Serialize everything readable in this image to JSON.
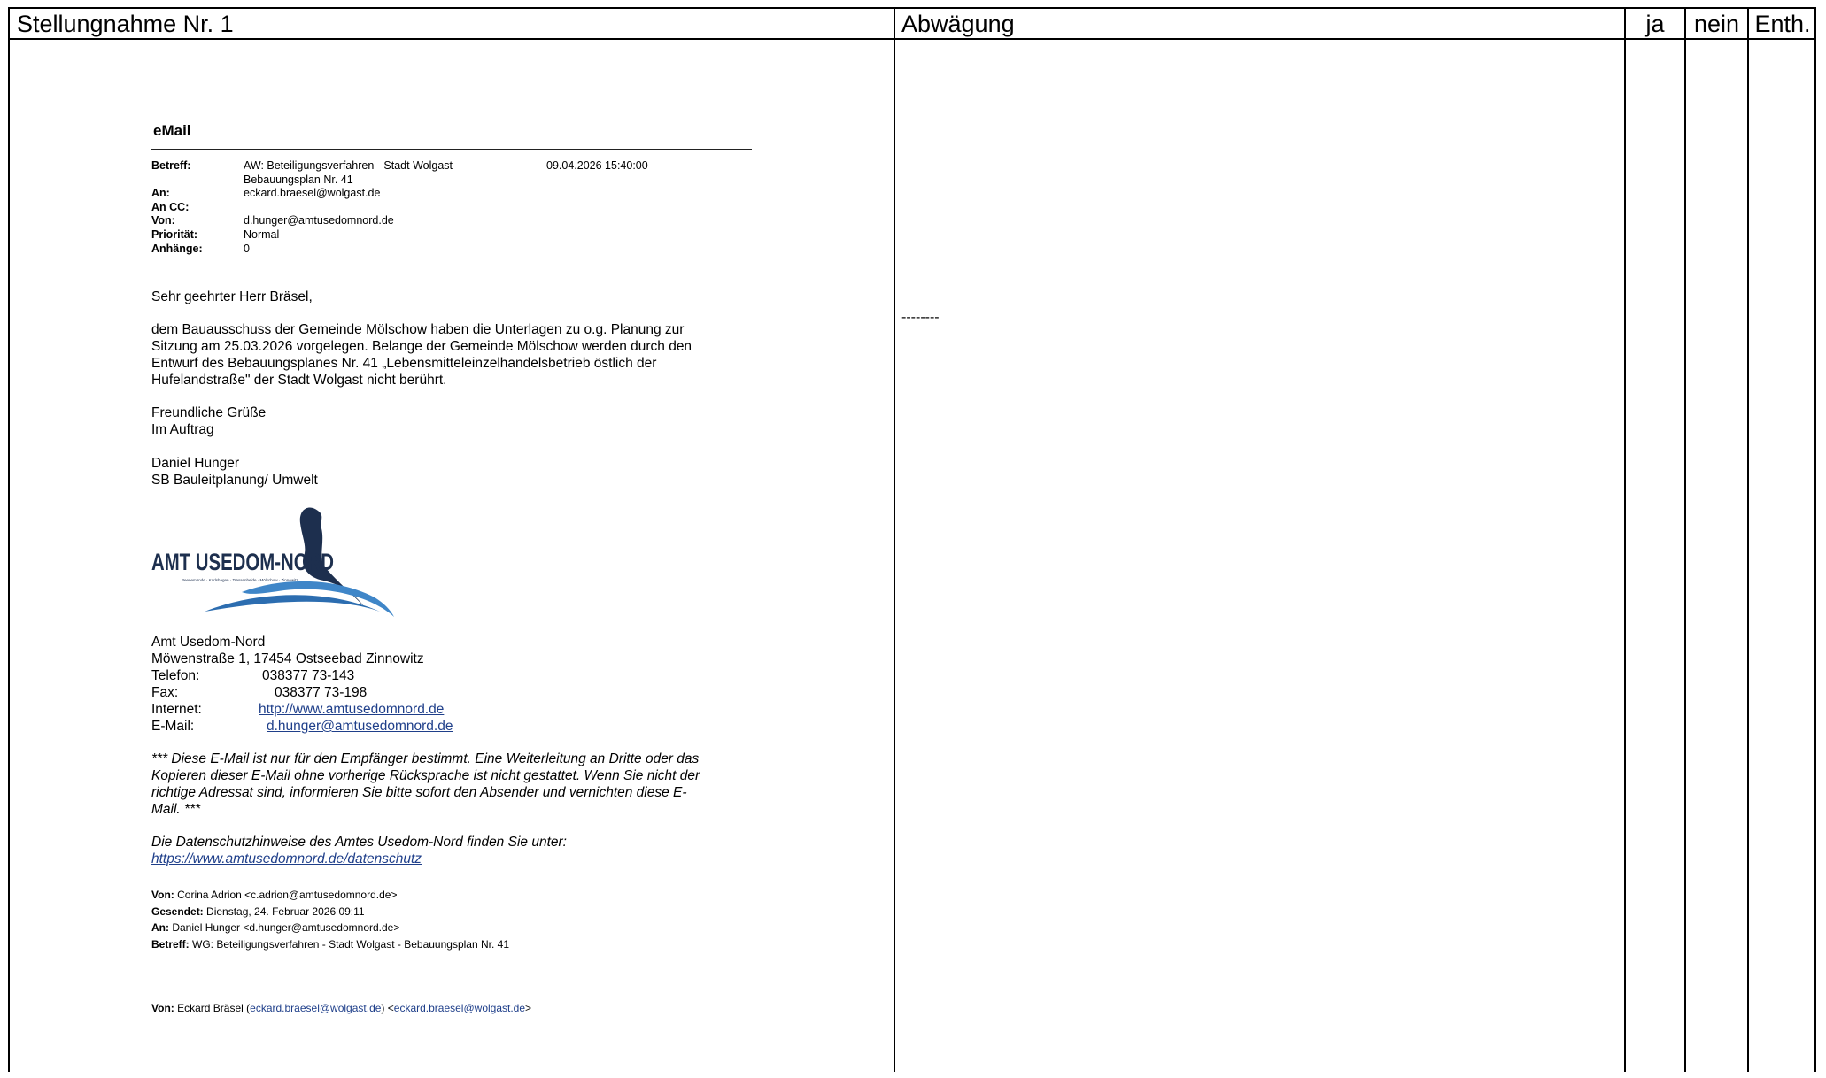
{
  "header": {
    "col1": "Stellungnahme Nr. 1",
    "col2": "Abwägung",
    "col3": "ja",
    "col4": "nein",
    "col5": "Enth."
  },
  "abwaegung_text": "--------",
  "email": {
    "title": "eMail",
    "meta": {
      "betreff_label": "Betreff:",
      "betreff_line1": "AW: Beteiligungsverfahren - Stadt Wolgast -",
      "betreff_line2": "Bebauungsplan Nr. 41",
      "date": "09.04.2026 15:40:00",
      "an_label": "An:",
      "an_value": "eckard.braesel@wolgast.de",
      "ancc_label": "An CC:",
      "von_label": "Von:",
      "von_value": "d.hunger@amtusedomnord.de",
      "prioritaet_label": "Priorität:",
      "prioritaet_value": "Normal",
      "anhaenge_label": "Anhänge:",
      "anhaenge_value": "0"
    },
    "salutation": "Sehr geehrter Herr Bräsel,",
    "body_lines": [
      "dem Bauausschuss der Gemeinde Mölschow haben die Unterlagen zu o.g. Planung zur",
      "Sitzung am 25.03.2026 vorgelegen. Belange der Gemeinde Mölschow werden durch den",
      "Entwurf des Bebauungsplanes Nr. 41 „Lebensmitteleinzelhandelsbetrieb östlich der",
      "Hufelandstraße\" der Stadt Wolgast nicht berührt."
    ],
    "closing1": "Freundliche Grüße",
    "closing2": "Im Auftrag",
    "sender_name": "Daniel Hunger",
    "sender_role": "SB Bauleitplanung/ Umwelt",
    "logo_text": "AMT USEDOM-NORD",
    "logo_subtext": "Peenemünde · Karlshagen · Trassenheide · Mölschow · Zinnowitz",
    "org_name": "Amt Usedom-Nord",
    "org_address": "Möwenstraße 1, 17454 Ostseebad Zinnowitz",
    "tel_label": "Telefon:",
    "tel_value": "038377 73-143",
    "fax_label": "Fax:",
    "fax_value": "038377 73-198",
    "internet_label": "Internet:",
    "internet_value": "http://www.amtusedomnord.de",
    "email_label": "E-Mail:",
    "email_value": "d.hunger@amtusedomnord.de",
    "disclaimer_lines": [
      "*** Diese E-Mail ist nur für den Empfänger bestimmt. Eine Weiterleitung an Dritte oder das",
      "Kopieren dieser E-Mail ohne vorherige Rücksprache ist nicht gestattet. Wenn Sie nicht der",
      "richtige Adressat sind, informieren Sie bitte sofort den Absender und vernichten diese E-",
      "Mail. ***"
    ],
    "privacy_line": "Die Datenschutzhinweise des Amtes Usedom-Nord finden Sie unter:",
    "privacy_link": "https://www.amtusedomnord.de/datenschutz",
    "forward": {
      "von_label": "Von:",
      "von_value": "Corina Adrion <c.adrion@amtusedomnord.de>",
      "gesendet_label": "Gesendet:",
      "gesendet_value": "Dienstag, 24. Februar 2026 09:11",
      "an_label": "An:",
      "an_value": "Daniel Hunger <d.hunger@amtusedomnord.de>",
      "betreff_label": "Betreff:",
      "betreff_value": "WG: Beteiligungsverfahren - Stadt Wolgast - Bebauungsplan Nr. 41"
    },
    "forward2": {
      "von_label": "Von:",
      "von_name": "Eckard Bräsel (",
      "von_link1": "eckard.braesel@wolgast.de",
      "von_mid": ") <",
      "von_link2": "eckard.braesel@wolgast.de",
      "von_end": ">"
    }
  }
}
